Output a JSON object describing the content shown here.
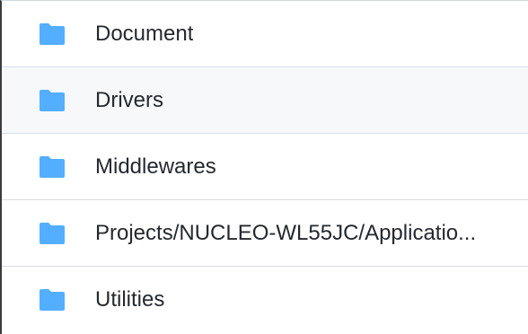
{
  "file_list": {
    "accent_color": "#54aeff",
    "hover_background": "#f6f8fa",
    "items": [
      {
        "label": "Document",
        "icon": "folder-icon",
        "type": "directory"
      },
      {
        "label": "Drivers",
        "icon": "folder-icon",
        "type": "directory",
        "hovered": true
      },
      {
        "label": "Middlewares",
        "icon": "folder-icon",
        "type": "directory"
      },
      {
        "label": "Projects/NUCLEO-WL55JC/Applicatio...",
        "icon": "folder-icon",
        "type": "directory"
      },
      {
        "label": "Utilities",
        "icon": "folder-icon",
        "type": "directory"
      }
    ]
  }
}
